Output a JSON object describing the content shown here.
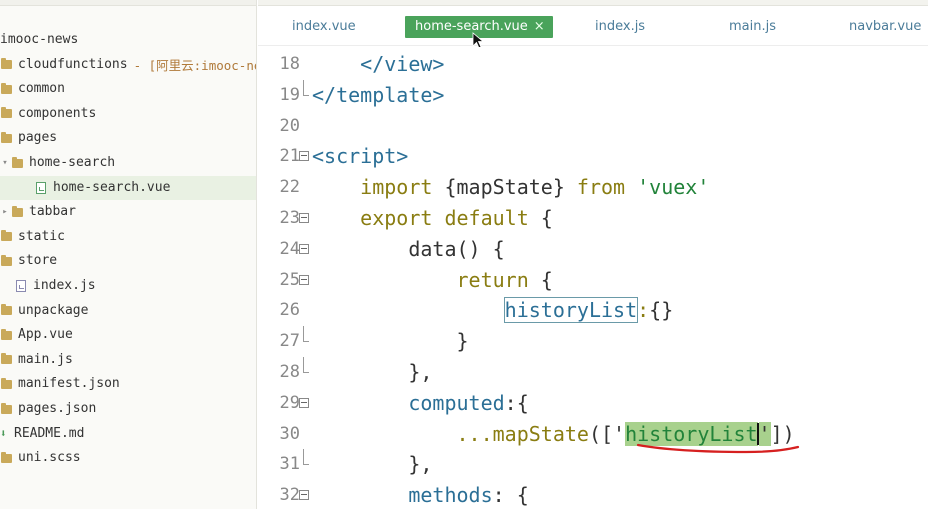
{
  "sidebar": {
    "items": [
      {
        "label": "imooc-news",
        "type": "root",
        "indent": 0
      },
      {
        "label": "cloudfunctions",
        "extra": "- [阿里云:imooc-ne",
        "type": "folder",
        "indent": 0
      },
      {
        "label": "common",
        "type": "folder",
        "indent": 0
      },
      {
        "label": "components",
        "type": "folder",
        "indent": 0
      },
      {
        "label": "pages",
        "type": "folder",
        "indent": 0
      },
      {
        "label": "home-search",
        "type": "folder-open",
        "indent": 1
      },
      {
        "label": "home-search.vue",
        "type": "vue-file",
        "indent": 2,
        "selected": true
      },
      {
        "label": "tabbar",
        "type": "folder-closed",
        "indent": 1
      },
      {
        "label": "static",
        "type": "folder",
        "indent": 0
      },
      {
        "label": "store",
        "type": "folder",
        "indent": 0
      },
      {
        "label": "index.js",
        "type": "file",
        "indent": 1
      },
      {
        "label": "unpackage",
        "type": "folder",
        "indent": 0
      },
      {
        "label": "App.vue",
        "type": "folder",
        "indent": 0
      },
      {
        "label": "main.js",
        "type": "folder",
        "indent": 0
      },
      {
        "label": "manifest.json",
        "type": "folder",
        "indent": 0
      },
      {
        "label": "pages.json",
        "type": "folder",
        "indent": 0
      },
      {
        "label": "README.md",
        "type": "down",
        "indent": 0
      },
      {
        "label": "uni.scss",
        "type": "folder",
        "indent": 0
      }
    ]
  },
  "tabs": [
    {
      "label": "index.vue",
      "active": false
    },
    {
      "label": "home-search.vue",
      "active": true,
      "close": "×"
    },
    {
      "label": "index.js",
      "active": false
    },
    {
      "label": "main.js",
      "active": false
    },
    {
      "label": "navbar.vue",
      "active": false
    }
  ],
  "editor": {
    "lines": [
      {
        "num": "18",
        "fold": "none",
        "code": "    </view>"
      },
      {
        "num": "19",
        "fold": "end",
        "code": "</template>"
      },
      {
        "num": "20",
        "fold": "none",
        "code": ""
      },
      {
        "num": "21",
        "fold": "box",
        "code": "<script>"
      },
      {
        "num": "22",
        "fold": "none",
        "code": "    import {mapState} from 'vuex'"
      },
      {
        "num": "23",
        "fold": "box",
        "code": "    export default {"
      },
      {
        "num": "24",
        "fold": "box",
        "code": "        data() {"
      },
      {
        "num": "25",
        "fold": "box",
        "code": "            return {"
      },
      {
        "num": "26",
        "fold": "none",
        "code": "                historyList:{}"
      },
      {
        "num": "27",
        "fold": "end",
        "code": "            }"
      },
      {
        "num": "28",
        "fold": "end",
        "code": "        },"
      },
      {
        "num": "29",
        "fold": "box",
        "code": "        computed:{"
      },
      {
        "num": "30",
        "fold": "none",
        "code": "            ...mapState(['historyList'])"
      },
      {
        "num": "31",
        "fold": "end",
        "code": "        },"
      },
      {
        "num": "32",
        "fold": "box",
        "code": "        methods: {"
      }
    ]
  },
  "colors": {
    "accent_tab": "#4aa35b",
    "tag": "#2b6f96",
    "keyword": "#8a7d12",
    "string": "#22833a",
    "highlight": "#a8d18d",
    "annotation_red": "#d62020"
  },
  "icons": {
    "folder": "folder-icon",
    "file": "file-icon",
    "vue_file": "vue-file-icon",
    "fold": "fold-toggle-icon",
    "pointer": "mouse-pointer-icon"
  }
}
